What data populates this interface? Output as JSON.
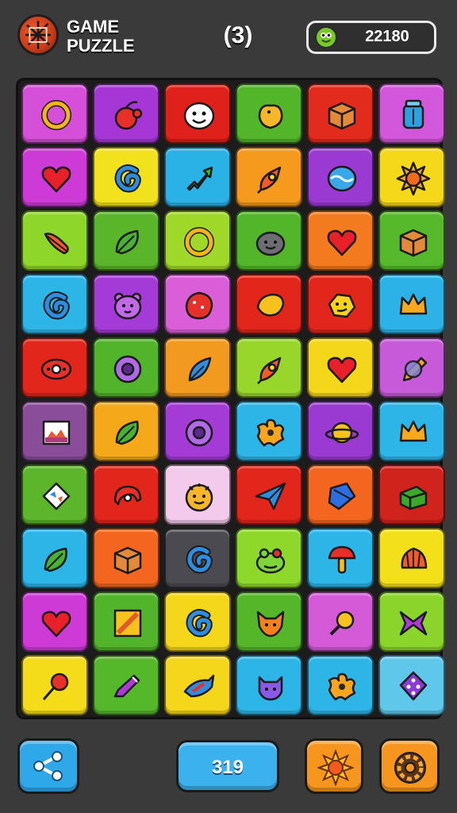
{
  "header": {
    "title_line1": "GAME",
    "title_line2": "PUZZLE",
    "level": "(3)",
    "score": "22180"
  },
  "footer": {
    "moves": "319"
  },
  "grid": {
    "columns": 6,
    "rows": 10,
    "tiles": [
      {
        "color": "#d64fd8",
        "icon": "ring-icon"
      },
      {
        "color": "#a637d6",
        "icon": "cherry-icon"
      },
      {
        "color": "#e0201a",
        "icon": "smiley-icon"
      },
      {
        "color": "#52b52a",
        "icon": "duck-icon"
      },
      {
        "color": "#e22a1d",
        "icon": "crate-icon"
      },
      {
        "color": "#d257da",
        "icon": "jar-icon"
      },
      {
        "color": "#cd3ad6",
        "icon": "heart-icon"
      },
      {
        "color": "#f2e21d",
        "icon": "swirl-icon"
      },
      {
        "color": "#2ab1e6",
        "icon": "arrow-icon"
      },
      {
        "color": "#f59a1d",
        "icon": "rocket-icon"
      },
      {
        "color": "#9a3ad2",
        "icon": "wave-icon"
      },
      {
        "color": "#f6d81a",
        "icon": "sun-icon"
      },
      {
        "color": "#8fd62b",
        "icon": "feather-icon"
      },
      {
        "color": "#5bb52b",
        "icon": "leaf-icon"
      },
      {
        "color": "#a0d82a",
        "icon": "ring-icon"
      },
      {
        "color": "#53b62a",
        "icon": "blob-face-icon"
      },
      {
        "color": "#f47a1f",
        "icon": "heart-icon"
      },
      {
        "color": "#56b92b",
        "icon": "crate-icon"
      },
      {
        "color": "#2eb5e8",
        "icon": "swirl-icon"
      },
      {
        "color": "#a43bd6",
        "icon": "bear-face-icon"
      },
      {
        "color": "#d95ed8",
        "icon": "berry-icon"
      },
      {
        "color": "#e2261c",
        "icon": "lemon-icon"
      },
      {
        "color": "#e2261c",
        "icon": "star-face-icon"
      },
      {
        "color": "#2cb2e6",
        "icon": "crown-icon"
      },
      {
        "color": "#e2261c",
        "icon": "eye-icon"
      },
      {
        "color": "#51b42a",
        "icon": "donut-icon"
      },
      {
        "color": "#f29a1f",
        "icon": "leaf-arrow-icon"
      },
      {
        "color": "#98d62c",
        "icon": "rocket-icon"
      },
      {
        "color": "#f4d61a",
        "icon": "heart-icon"
      },
      {
        "color": "#c65ad8",
        "icon": "pen-icon"
      },
      {
        "color": "#8a4d9a",
        "icon": "picture-icon"
      },
      {
        "color": "#f4a81a",
        "icon": "leaf-icon"
      },
      {
        "color": "#a43bd6",
        "icon": "donut-icon"
      },
      {
        "color": "#2eb5e8",
        "icon": "flower-icon"
      },
      {
        "color": "#9a3ad2",
        "icon": "planet-icon"
      },
      {
        "color": "#2eb5e8",
        "icon": "crown-icon"
      },
      {
        "color": "#5cb52b",
        "icon": "kite-icon"
      },
      {
        "color": "#e2261c",
        "icon": "helmet-icon"
      },
      {
        "color": "#f3c9ec",
        "icon": "lion-face-icon"
      },
      {
        "color": "#e2261c",
        "icon": "paper-plane-icon"
      },
      {
        "color": "#f4661f",
        "icon": "box-icon"
      },
      {
        "color": "#d0231c",
        "icon": "cube-icon"
      },
      {
        "color": "#2eb5e8",
        "icon": "leaf-icon"
      },
      {
        "color": "#f4661f",
        "icon": "crate-icon"
      },
      {
        "color": "#4a4a50",
        "icon": "swirl-icon"
      },
      {
        "color": "#8ed82c",
        "icon": "frog-face-icon"
      },
      {
        "color": "#2eb5e8",
        "icon": "mushroom-icon"
      },
      {
        "color": "#f4e01a",
        "icon": "shell-icon"
      },
      {
        "color": "#cd3ad6",
        "icon": "heart-icon"
      },
      {
        "color": "#51b42a",
        "icon": "pencil-icon"
      },
      {
        "color": "#f4d61a",
        "icon": "swirl-icon"
      },
      {
        "color": "#55b62a",
        "icon": "fox-face-icon"
      },
      {
        "color": "#d55ad8",
        "icon": "key-icon"
      },
      {
        "color": "#8bd42c",
        "icon": "bow-icon"
      },
      {
        "color": "#f4dc1a",
        "icon": "pin-icon"
      },
      {
        "color": "#55b82a",
        "icon": "crayon-icon"
      },
      {
        "color": "#f4d61a",
        "icon": "fish-icon"
      },
      {
        "color": "#2eb5e8",
        "icon": "cat-face-icon"
      },
      {
        "color": "#2eb5e8",
        "icon": "flower-icon"
      },
      {
        "color": "#5fc8ea",
        "icon": "dice-icon"
      }
    ]
  }
}
